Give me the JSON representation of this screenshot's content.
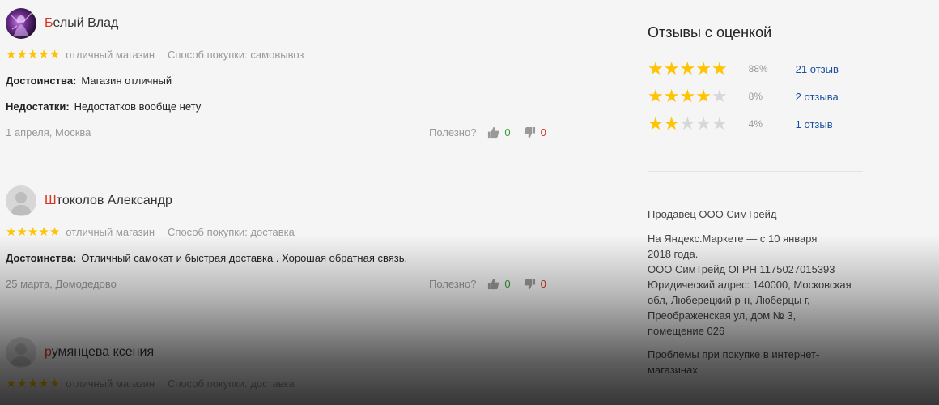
{
  "reviews": [
    {
      "author_first": "Б",
      "author_rest": "елый Влад",
      "avatar": "photo",
      "rating": 5,
      "grade": "отличный магазин",
      "method": "Способ покупки: самовывоз",
      "pros_label": "Достоинства:",
      "pros": "Магазин отличный",
      "cons_label": "Недостатки:",
      "cons": "Недостатков вообще нету",
      "date": "1 апреля, Москва",
      "useful_label": "Полезно?",
      "likes": "0",
      "dislikes": "0"
    },
    {
      "author_first": "Ш",
      "author_rest": "токолов Александр",
      "avatar": "default",
      "rating": 5,
      "grade": "отличный магазин",
      "method": "Способ покупки: доставка",
      "pros_label": "Достоинства:",
      "pros": "Отличный самокат и быстрая доставка . Хорошая обратная связь.",
      "date": "25 марта, Домодедово",
      "useful_label": "Полезно?",
      "likes": "0",
      "dislikes": "0"
    },
    {
      "author_first": "р",
      "author_rest": "умянцева ксения",
      "avatar": "default",
      "rating": 5,
      "grade": "отличный магазин",
      "method": "Способ покупки: доставка"
    }
  ],
  "side": {
    "title": "Отзывы с оценкой",
    "rows": [
      {
        "stars": 5,
        "pct": "88%",
        "link": "21 отзыв"
      },
      {
        "stars": 4,
        "pct": "8%",
        "link": "2 отзыва"
      },
      {
        "stars": 2,
        "pct": "4%",
        "link": "1 отзыв"
      }
    ],
    "seller": "Продавец ООО СимТрейд",
    "info_1": "На Яндекс.Маркете — с 10 января",
    "info_2": "2018 года.",
    "info_3": "ООО СимТрейд ОГРН 1175027015393",
    "info_4": "Юридический адрес: 140000, Московская",
    "info_5": "обл, Люберецкий р-н, Люберцы г,",
    "info_6": "Преображенская ул, дом № 3,",
    "info_7": "помещение 026",
    "problems_1": "Проблемы при покупке в интернет-",
    "problems_2": "магазинах"
  },
  "colors": {
    "star_on": "#ffc300",
    "star_off": "#d7d7d7",
    "author_initial": "#d8331f",
    "link": "#1a4fa0",
    "like": "#2f9e2f",
    "dislike": "#d8331f"
  },
  "icons": {
    "thumb_up": "thumb-up-icon",
    "thumb_down": "thumb-down-icon",
    "user": "user-avatar-icon",
    "star": "star-icon"
  }
}
